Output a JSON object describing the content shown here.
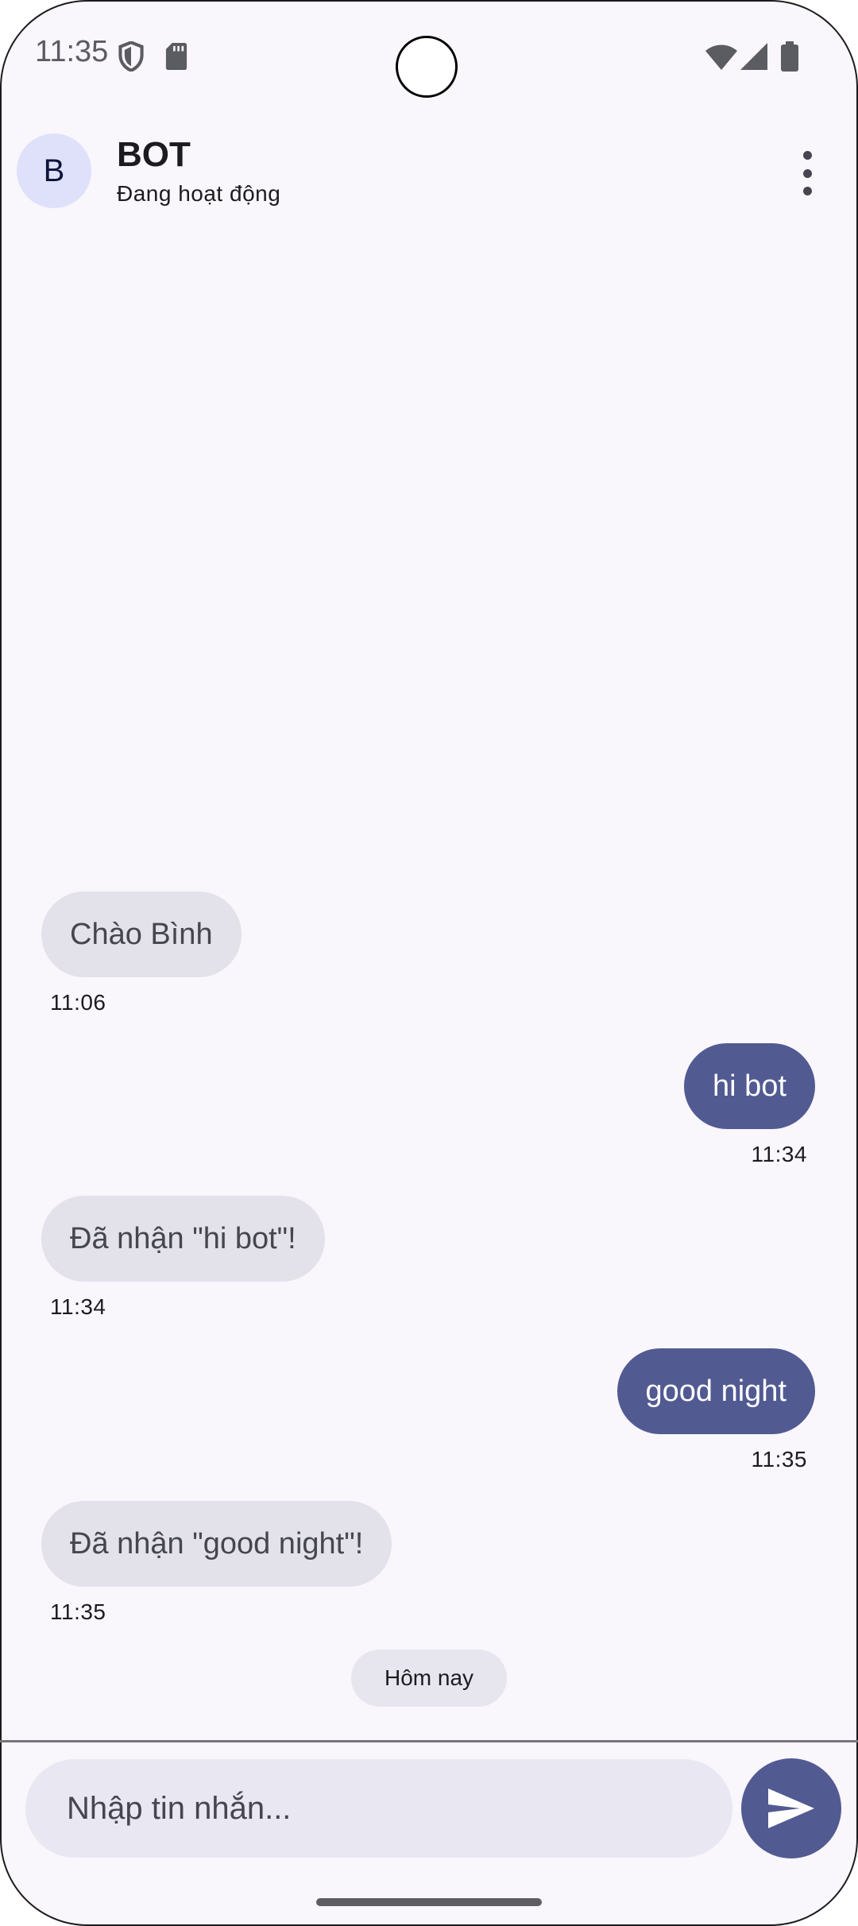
{
  "status_bar": {
    "time": "11:35",
    "icons": [
      "shield-icon",
      "sd-card-icon",
      "wifi-icon",
      "signal-icon",
      "battery-icon"
    ]
  },
  "header": {
    "avatar_letter": "B",
    "title": "BOT",
    "subtitle": "Đang hoạt động",
    "menu_icon": "more-vert-icon"
  },
  "messages": [
    {
      "direction": "incoming",
      "text": "Chào Bình",
      "time": "11:06"
    },
    {
      "direction": "outgoing",
      "text": "hi bot",
      "time": "11:34"
    },
    {
      "direction": "incoming",
      "text": "Đã nhận \"hi bot\"!",
      "time": "11:34"
    },
    {
      "direction": "outgoing",
      "text": "good night",
      "time": "11:35"
    },
    {
      "direction": "incoming",
      "text": "Đã nhận \"good night\"!",
      "time": "11:35"
    }
  ],
  "date_chip": "Hôm nay",
  "composer": {
    "placeholder": "Nhập tin nhắn...",
    "send_icon": "send-icon"
  },
  "colors": {
    "background": "#f9f6fc",
    "incoming_bubble": "#e3e2ea",
    "outgoing_bubble": "#525a92",
    "avatar_bg": "#dfe1fb"
  }
}
